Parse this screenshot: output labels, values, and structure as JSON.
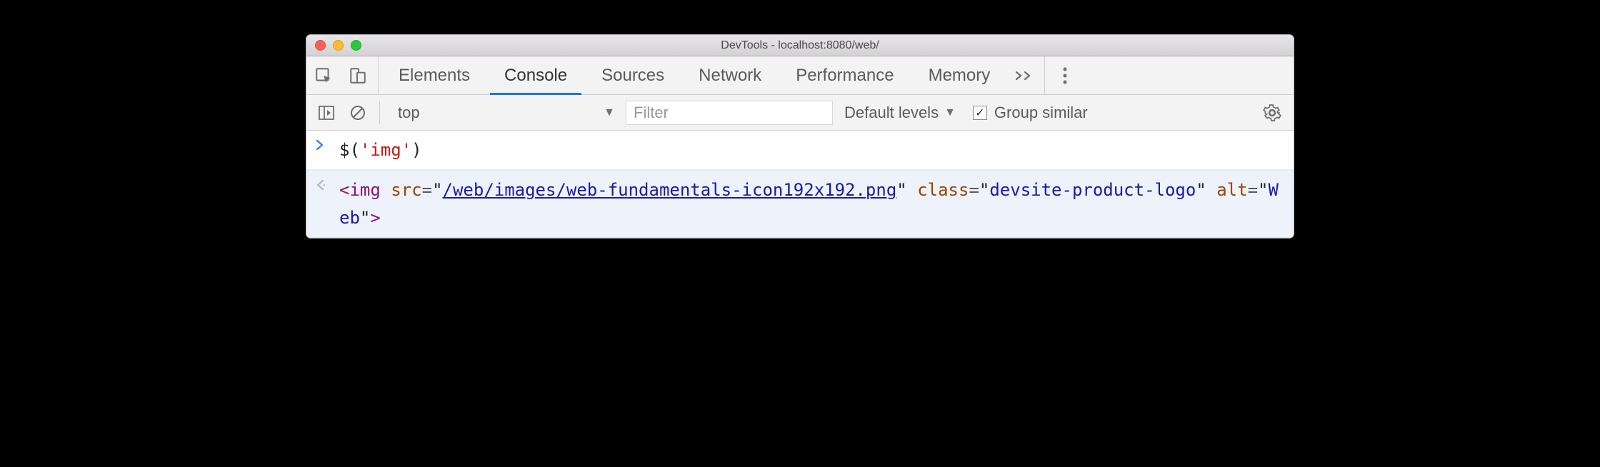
{
  "window": {
    "title": "DevTools - localhost:8080/web/"
  },
  "tabs": {
    "items": [
      "Elements",
      "Console",
      "Sources",
      "Network",
      "Performance",
      "Memory"
    ],
    "active_index": 1
  },
  "toolbar": {
    "context": "top",
    "filter_placeholder": "Filter",
    "levels_label": "Default levels",
    "group_similar_label": "Group similar",
    "group_similar_checked": true
  },
  "console": {
    "input": {
      "func": "$",
      "arg": "'img'"
    },
    "result": {
      "tag": "img",
      "attrs": [
        {
          "name": "src",
          "value": "/web/images/web-fundamentals-icon192x192.png",
          "link": true
        },
        {
          "name": "class",
          "value": "devsite-product-logo",
          "link": false
        },
        {
          "name": "alt",
          "value": "Web",
          "link": false
        }
      ]
    }
  }
}
